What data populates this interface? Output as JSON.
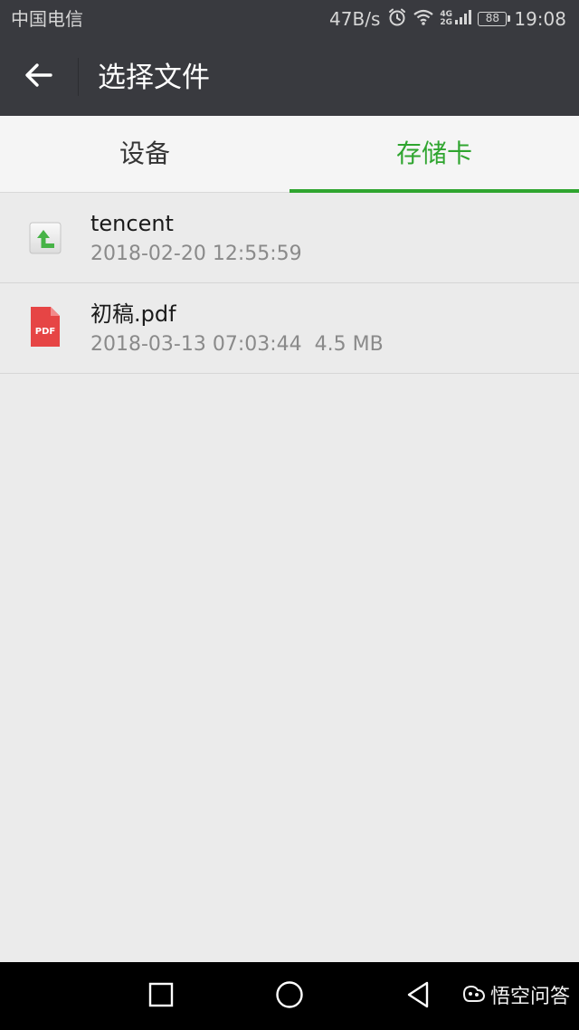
{
  "status_bar": {
    "carrier": "中国电信",
    "net_speed": "47B/s",
    "network_top": "4G",
    "network_bottom": "2G",
    "battery": "88",
    "time": "19:08"
  },
  "header": {
    "title": "选择文件",
    "back_icon": "arrow-left-icon"
  },
  "tabs": [
    {
      "label": "设备",
      "active": false
    },
    {
      "label": "存储卡",
      "active": true
    }
  ],
  "accent_color": "#2fa52f",
  "files": [
    {
      "name": "tencent",
      "meta": "2018-02-20 12:55:59",
      "icon": "folder-up-icon"
    },
    {
      "name": "初稿.pdf",
      "meta": "2018-03-13 07:03:44  4.5 MB",
      "icon": "pdf-file-icon",
      "icon_text": "PDF"
    }
  ],
  "nav_bar": {
    "recent_icon": "square-icon",
    "home_icon": "circle-icon",
    "back_icon": "triangle-back-icon"
  },
  "watermark": {
    "text": "悟空问答"
  }
}
